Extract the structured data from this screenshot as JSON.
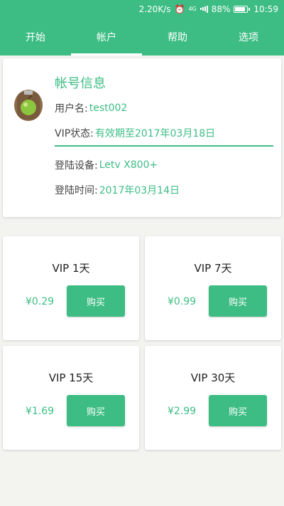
{
  "status_bar": {
    "speed": "2.20K/s",
    "network": "4G",
    "battery": "88%",
    "battery_level": 0.88,
    "time": "10:59",
    "icons": [
      "alarm-icon",
      "signal-icon",
      "battery-icon"
    ]
  },
  "tabs": [
    {
      "label": "开始",
      "active": false
    },
    {
      "label": "帐户",
      "active": true
    },
    {
      "label": "帮助",
      "active": false
    },
    {
      "label": "选项",
      "active": false
    }
  ],
  "account": {
    "title": "帐号信息",
    "username_label": "用户名:",
    "username": "test002",
    "vip_label": "VIP状态:",
    "vip_status": "有效期至2017年03月18日",
    "device_label": "登陆设备:",
    "device": "Letv X800+",
    "login_time_label": "登陆时间:",
    "login_time": "2017年03月14日",
    "avatar_icon": "apple-clipboard-icon"
  },
  "plans": [
    {
      "name": "VIP 1天",
      "price": "¥0.29",
      "button": "购买"
    },
    {
      "name": "VIP 7天",
      "price": "¥0.99",
      "button": "购买"
    },
    {
      "name": "VIP 15天",
      "price": "¥1.69",
      "button": "购买"
    },
    {
      "name": "VIP 30天",
      "price": "¥2.99",
      "button": "购买"
    }
  ],
  "colors": {
    "accent": "#3dbd84",
    "background": "#f3f3f0"
  }
}
